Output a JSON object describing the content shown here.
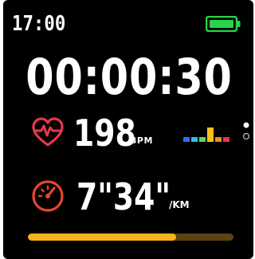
{
  "status": {
    "time": "17:00",
    "battery_icon": "battery-full-icon",
    "battery_color": "#27d34a"
  },
  "workout": {
    "elapsed": "00:00:30"
  },
  "heart_rate": {
    "icon": "heart-pulse-icon",
    "icon_color": "#e8364a",
    "value": "198",
    "unit": "BPM"
  },
  "hr_zones": {
    "icon": "heart-rate-zone-chart",
    "levels": [
      1,
      1,
      1,
      3,
      1,
      1
    ],
    "colors": [
      "#2f6bff",
      "#2fbfe0",
      "#5fd35a",
      "#f6c21a",
      "#f08a2a",
      "#e8364a"
    ]
  },
  "page_indicator": {
    "pages": 2,
    "active": 0
  },
  "pace": {
    "icon": "speedometer-icon",
    "icon_color": "#e8452f",
    "value": "7\"34\"",
    "unit": "/KM"
  },
  "progress": {
    "fraction": 0.72,
    "fill_color": "#f6b21a",
    "track_color": "#5a4310"
  }
}
